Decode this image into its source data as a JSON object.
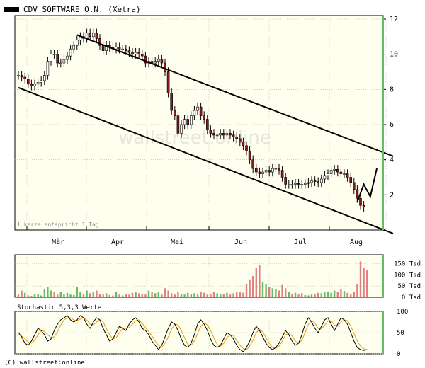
{
  "title": "CDV SOFTWARE O.N. (Xetra)",
  "note": "1 kerze entspricht 1 Tag",
  "watermark": "wallstreet:online",
  "footer": "(C) wallstreet:online",
  "colors": {
    "plot_bg": "#fffff0",
    "up": "#ffffff",
    "down": "#8b1a1a",
    "grid": "#b8b8a8",
    "vol_up": "#66bb66",
    "vol_down": "#e08080",
    "stoch_k": "#000000",
    "stoch_d": "#e0a000",
    "right_bar": "#66bb66"
  },
  "chart_data": [
    {
      "type": "candlestick",
      "title": "CDV SOFTWARE O.N. (Xetra)",
      "x_ticks": [
        "Mär",
        "Apr",
        "Mai",
        "Jun",
        "Jul",
        "Aug"
      ],
      "y_ticks": [
        2,
        4,
        6,
        8,
        10,
        12
      ],
      "ylim": [
        0,
        12.2
      ],
      "grid": true,
      "closes": [
        8.8,
        8.7,
        8.6,
        8.3,
        8.2,
        8.3,
        8.4,
        8.5,
        8.8,
        9.6,
        10.0,
        10.0,
        9.5,
        9.5,
        9.7,
        9.9,
        10.3,
        10.5,
        10.8,
        11.0,
        10.9,
        11.2,
        11.0,
        11.2,
        10.9,
        10.5,
        10.2,
        10.5,
        10.4,
        10.3,
        10.4,
        10.3,
        10.3,
        10.2,
        10.1,
        10.0,
        10.1,
        10.0,
        9.9,
        9.5,
        9.6,
        9.5,
        9.6,
        9.7,
        9.5,
        9.0,
        7.8,
        6.8,
        6.5,
        5.5,
        6.0,
        6.3,
        6.0,
        6.5,
        6.8,
        7.0,
        6.5,
        6.3,
        5.7,
        5.5,
        5.4,
        5.4,
        5.5,
        5.4,
        5.5,
        5.4,
        5.3,
        5.2,
        5.0,
        4.8,
        4.5,
        4.0,
        3.5,
        3.3,
        3.2,
        3.3,
        3.4,
        3.3,
        3.5,
        3.5,
        3.4,
        3.0,
        2.6,
        2.6,
        2.6,
        2.65,
        2.6,
        2.6,
        2.65,
        2.7,
        2.8,
        2.75,
        2.7,
        2.9,
        3.1,
        3.2,
        3.4,
        3.45,
        3.3,
        3.2,
        3.2,
        3.0,
        2.7,
        2.3,
        1.8,
        1.4,
        1.3
      ],
      "trend_lines": [
        {
          "from": [
            0,
            8.1
          ],
          "to": [
            115,
            -0.2
          ]
        },
        {
          "from": [
            18,
            11.1
          ],
          "to": [
            115,
            4.2
          ]
        }
      ],
      "projection": [
        [
          104,
          1.6
        ],
        [
          106,
          2.6
        ],
        [
          108,
          1.9
        ],
        [
          110,
          3.5
        ]
      ]
    },
    {
      "type": "bar",
      "ylabel_ticks": [
        "150 Tsd",
        "100 Tsd",
        "50 Tsd",
        "0 Tsd"
      ],
      "ylim": [
        0,
        190
      ],
      "unit": "Tsd",
      "values": [
        12,
        30,
        20,
        8,
        6,
        15,
        12,
        8,
        35,
        45,
        30,
        22,
        12,
        25,
        15,
        20,
        12,
        10,
        45,
        22,
        15,
        30,
        18,
        22,
        30,
        15,
        12,
        18,
        10,
        8,
        25,
        12,
        8,
        15,
        12,
        20,
        22,
        18,
        15,
        12,
        30,
        22,
        18,
        25,
        12,
        40,
        30,
        18,
        12,
        25,
        15,
        12,
        20,
        15,
        18,
        12,
        25,
        20,
        12,
        15,
        22,
        18,
        12,
        15,
        20,
        12,
        18,
        25,
        22,
        20,
        60,
        80,
        95,
        130,
        145,
        70,
        60,
        45,
        40,
        35,
        30,
        55,
        40,
        25,
        15,
        20,
        12,
        18,
        10,
        8,
        12,
        15,
        20,
        18,
        22,
        25,
        20,
        30,
        25,
        35,
        28,
        20,
        15,
        25,
        60,
        160,
        130,
        120
      ],
      "up_flags": [
        0,
        0,
        1,
        0,
        0,
        1,
        1,
        1,
        1,
        1,
        1,
        0,
        0,
        1,
        1,
        1,
        1,
        1,
        1,
        1,
        0,
        1,
        0,
        1,
        0,
        0,
        0,
        1,
        0,
        0,
        1,
        0,
        1,
        0,
        0,
        0,
        1,
        0,
        0,
        0,
        1,
        0,
        1,
        1,
        0,
        0,
        0,
        0,
        0,
        0,
        1,
        1,
        0,
        1,
        1,
        1,
        0,
        0,
        0,
        0,
        0,
        1,
        1,
        0,
        1,
        0,
        0,
        0,
        0,
        0,
        0,
        0,
        0,
        0,
        0,
        1,
        1,
        0,
        1,
        1,
        0,
        0,
        0,
        1,
        0,
        1,
        0,
        0,
        1,
        1,
        1,
        0,
        0,
        1,
        1,
        1,
        1,
        1,
        0,
        0,
        1,
        0,
        0,
        0,
        0,
        0,
        0,
        0
      ]
    },
    {
      "type": "line",
      "title": "Stochastic 5,3,3 Werte",
      "y_ticks": [
        0,
        50,
        100
      ],
      "ylim": [
        0,
        100
      ],
      "series": [
        {
          "values": [
            50,
            40,
            25,
            20,
            30,
            45,
            60,
            55,
            45,
            30,
            35,
            55,
            70,
            80,
            85,
            90,
            80,
            75,
            80,
            90,
            85,
            70,
            60,
            75,
            85,
            80,
            60,
            45,
            30,
            35,
            50,
            65,
            60,
            55,
            70,
            80,
            85,
            75,
            60,
            55,
            45,
            30,
            20,
            10,
            20,
            40,
            60,
            75,
            70,
            55,
            35,
            20,
            15,
            25,
            45,
            70,
            80,
            70,
            55,
            35,
            20,
            15,
            20,
            35,
            50,
            45,
            35,
            20,
            10,
            5,
            15,
            30,
            50,
            65,
            55,
            40,
            25,
            15,
            10,
            15,
            25,
            40,
            55,
            45,
            30,
            20,
            25,
            45,
            70,
            85,
            75,
            60,
            50,
            65,
            80,
            85,
            70,
            55,
            70,
            85,
            80,
            70,
            50,
            30,
            15,
            10,
            8,
            10
          ]
        },
        {
          "values": [
            45,
            42,
            35,
            28,
            25,
            32,
            45,
            55,
            53,
            45,
            38,
            40,
            52,
            68,
            80,
            85,
            85,
            80,
            78,
            82,
            85,
            80,
            70,
            68,
            75,
            80,
            75,
            60,
            45,
            35,
            38,
            50,
            60,
            60,
            62,
            70,
            78,
            80,
            72,
            62,
            52,
            42,
            30,
            20,
            15,
            25,
            40,
            58,
            70,
            68,
            55,
            38,
            22,
            20,
            30,
            48,
            65,
            73,
            68,
            55,
            38,
            22,
            18,
            25,
            38,
            45,
            43,
            32,
            20,
            12,
            10,
            18,
            32,
            50,
            58,
            52,
            38,
            25,
            15,
            13,
            18,
            30,
            45,
            48,
            42,
            30,
            25,
            32,
            50,
            70,
            78,
            73,
            60,
            58,
            68,
            78,
            78,
            68,
            65,
            75,
            80,
            78,
            65,
            48,
            30,
            18,
            12,
            9
          ]
        }
      ]
    }
  ]
}
